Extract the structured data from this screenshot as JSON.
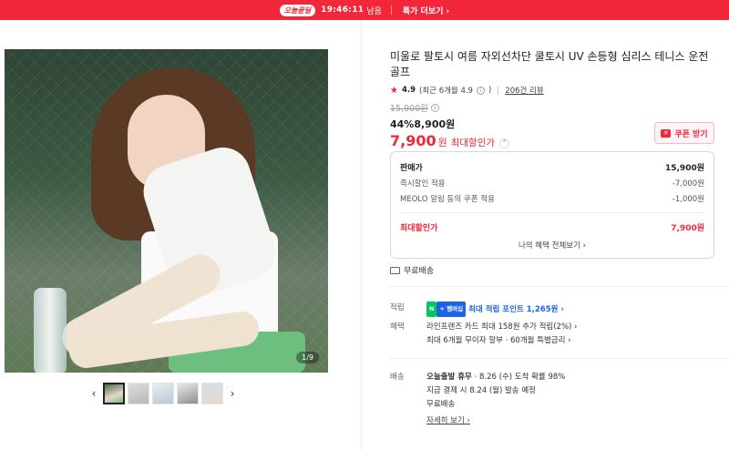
{
  "topbar": {
    "deal_label": "오늘끝딜",
    "timer": "19:46:11",
    "timer_suffix": "남음",
    "more_label": "특가 더보기 ›"
  },
  "gallery": {
    "counter": "1/9",
    "prev": "‹",
    "next": "›",
    "thumb_count": 5
  },
  "product": {
    "title": "미울로 팔토시 여름 자외선차단 쿨토시 UV 손등형 심리스 테니스 운전 골프",
    "rating": "4.9",
    "rating_detail": "(최근 6개월 4.9",
    "reviews": "206건 리뷰",
    "original_price": "15,900원",
    "sale_pct": "44%",
    "sale_price": "8,900원",
    "max_price": "7,900",
    "max_won": "원",
    "max_label": "최대할인가",
    "coupon_label": "쿠폰 받기"
  },
  "price_box": {
    "rows": [
      {
        "label": "판매가",
        "value": "15,900원"
      },
      {
        "label": "즉시할인 적용",
        "value": "-7,000원"
      },
      {
        "label": "MEOLO 알림 동의 쿠폰 적용",
        "value": "-1,000원"
      }
    ],
    "max_label": "최대할인가",
    "max_value": "7,900원",
    "all_benefits": "나의 혜택 전체보기 ›"
  },
  "shipping": {
    "free": "무료배송"
  },
  "points": {
    "label": "적립",
    "n_badge": "N",
    "plus_badge": "+ 멤버십",
    "text": "최대 적립 포인트 1,265원 ›"
  },
  "benefits": {
    "label": "혜택",
    "line1": "라인프렌즈 카드 최대 158원 추가 적립(2%) ›",
    "line2": "최대 6개월 무이자 할부 · 60개월 특별금리 ›"
  },
  "delivery": {
    "label": "배송",
    "line1_bold": "오늘출발 휴무",
    "line1_rest": " · 8.26 (수) 도착 확률 98%",
    "line2": "지금 결제 시 8.24 (월) 발송 예정",
    "line3": "무료배송",
    "detail": "자세히 보기 ›"
  },
  "colors": {
    "accent": "#f2273a",
    "points_blue": "#1b62e6",
    "naver_green": "#03c75a"
  }
}
